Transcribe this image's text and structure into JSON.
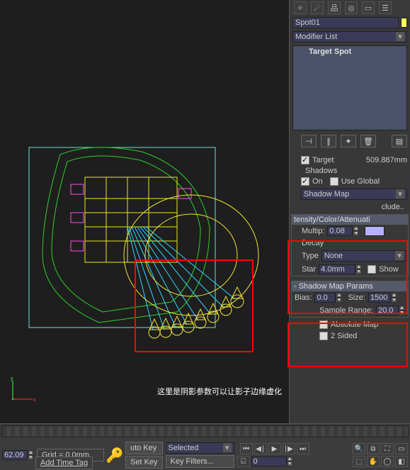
{
  "object_name": "Spot01",
  "modifier_list_label": "Modifier List",
  "mod_stack_item": "Target Spot",
  "target": {
    "label": "Target",
    "value": "509.887mm"
  },
  "shadows": {
    "title": "Shadows",
    "on_label": "On",
    "use_global_label": "Use Global",
    "type": "Shadow Map",
    "exclude_label": "clude.."
  },
  "intensity": {
    "title": "tensity/Color/Attenuati",
    "multip_label": "Multip:",
    "multip_value": "0.08",
    "decay_label": "Decay",
    "type_label": "Type",
    "type_value": "None",
    "start_label": "Star",
    "start_value": "4.0mm",
    "show_label": "Show"
  },
  "shadow_map": {
    "title": "-  Shadow Map Params",
    "bias_label": "Bias:",
    "bias_value": "0.0",
    "size_label": "Size:",
    "size_value": "1500",
    "sample_label": "Sample Range:",
    "sample_value": "20.0",
    "abs_map_label": "Absolute Map",
    "two_sided_label": "2 Sided"
  },
  "overlay_text": "这里是阴影参数可以让影子边缘虚化",
  "bottom": {
    "coord": "62.09",
    "grid": "Grid = 0.0mm",
    "auto_key": "uto Key",
    "set_key": "Set Key",
    "selected": "Selected",
    "key_filters": "Key Filters...",
    "frame": "0",
    "add_time_tag": "Add Time Tag"
  }
}
